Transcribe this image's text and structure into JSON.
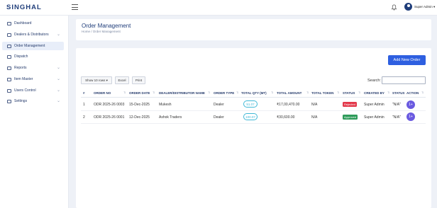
{
  "app": {
    "brand": "SINGHAL"
  },
  "topbar": {
    "user_name": "Super Admin ▾"
  },
  "sidebar": {
    "items": [
      {
        "label": "Dashboard",
        "icon": "dashboard-icon",
        "chevron": ""
      },
      {
        "label": "Dealers & Distributors",
        "icon": "users-icon",
        "chevron": "⌄"
      },
      {
        "label": "Order Management",
        "icon": "cart-icon",
        "chevron": ""
      },
      {
        "label": "Dispatch",
        "icon": "truck-icon",
        "chevron": ""
      },
      {
        "label": "Reports",
        "icon": "report-icon",
        "chevron": "⌄"
      },
      {
        "label": "Item Master",
        "icon": "box-icon",
        "chevron": "⌄"
      },
      {
        "label": "Users Control",
        "icon": "user-control-icon",
        "chevron": "⌄"
      },
      {
        "label": "Settings",
        "icon": "gear-icon",
        "chevron": "⌄"
      }
    ],
    "active_index": 2
  },
  "header": {
    "title": "Order Management",
    "breadcrumb": "Home  /  Order Management"
  },
  "toolbar": {
    "add_button": "Add New Order",
    "show_rows": "Show 10 rows  ▾",
    "excel": "Excel",
    "print": "Print",
    "search_label": "Search:",
    "search_value": ""
  },
  "table": {
    "columns": [
      "#",
      "ORDER NO",
      "ORDER DATE",
      "DEALER/DISTRIBUTOR NAME",
      "ORDER TYPE",
      "TOTAL QTY (MT)",
      "TOTAL AMOUNT",
      "TOTAL TOKEN",
      "STATUS",
      "CREATED BY",
      "STATUS",
      "ACTION"
    ],
    "rows": [
      {
        "index": "1",
        "order_no": "ODR 2025-26 0003",
        "order_date": "15-Dec-2025",
        "dealer": "Mukesh",
        "type": "Dealer",
        "qty": "51.07",
        "amount": "₹17,00,470.00",
        "token": "N/A",
        "status": "Rejected",
        "status_color": "#e3384a",
        "created_by": "Super Admin",
        "status2": "\"N/A\"",
        "action": "1+"
      },
      {
        "index": "2",
        "order_no": "ODR 2025-26 0001",
        "order_date": "12-Dec-2025",
        "dealer": "Ashok Traders",
        "type": "Dealer",
        "qty": "100.07",
        "amount": "₹30,600.00",
        "token": "N/A",
        "status": "Approved",
        "status_color": "#2e9b5a",
        "created_by": "Super Admin",
        "status2": "\"N/A\"",
        "action": "1+"
      }
    ]
  }
}
